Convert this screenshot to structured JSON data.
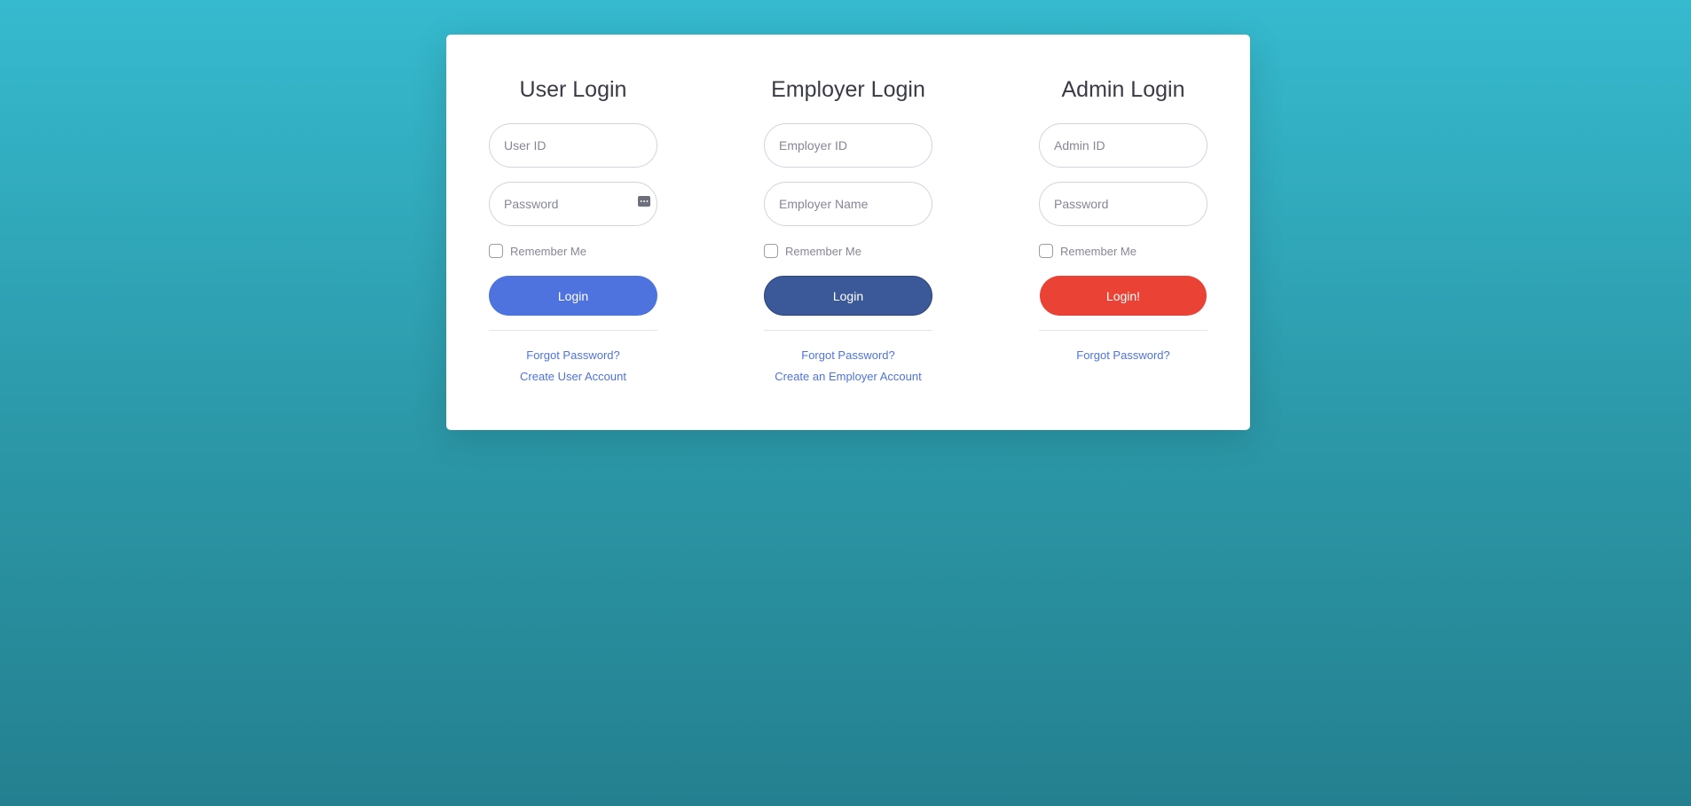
{
  "user_login": {
    "title": "User Login",
    "id_placeholder": "User ID",
    "password_placeholder": "Password",
    "remember_label": "Remember Me",
    "button_label": "Login",
    "forgot_link": "Forgot Password?",
    "create_link": "Create User Account"
  },
  "employer_login": {
    "title": "Employer Login",
    "id_placeholder": "Employer ID",
    "name_placeholder": "Employer Name",
    "remember_label": "Remember Me",
    "button_label": "Login",
    "forgot_link": "Forgot Password?",
    "create_link": "Create an Employer Account"
  },
  "admin_login": {
    "title": "Admin Login",
    "id_placeholder": "Admin ID",
    "password_placeholder": "Password",
    "remember_label": "Remember Me",
    "button_label": "Login!",
    "forgot_link": "Forgot Password?"
  },
  "colors": {
    "background_top": "#36bacf",
    "background_bottom": "#24808f",
    "user_button": "#4e73df",
    "employer_button": "#3b5998",
    "admin_button": "#ea4335",
    "link": "#4e73df"
  },
  "icons": {
    "password_manager": "key-icon"
  }
}
